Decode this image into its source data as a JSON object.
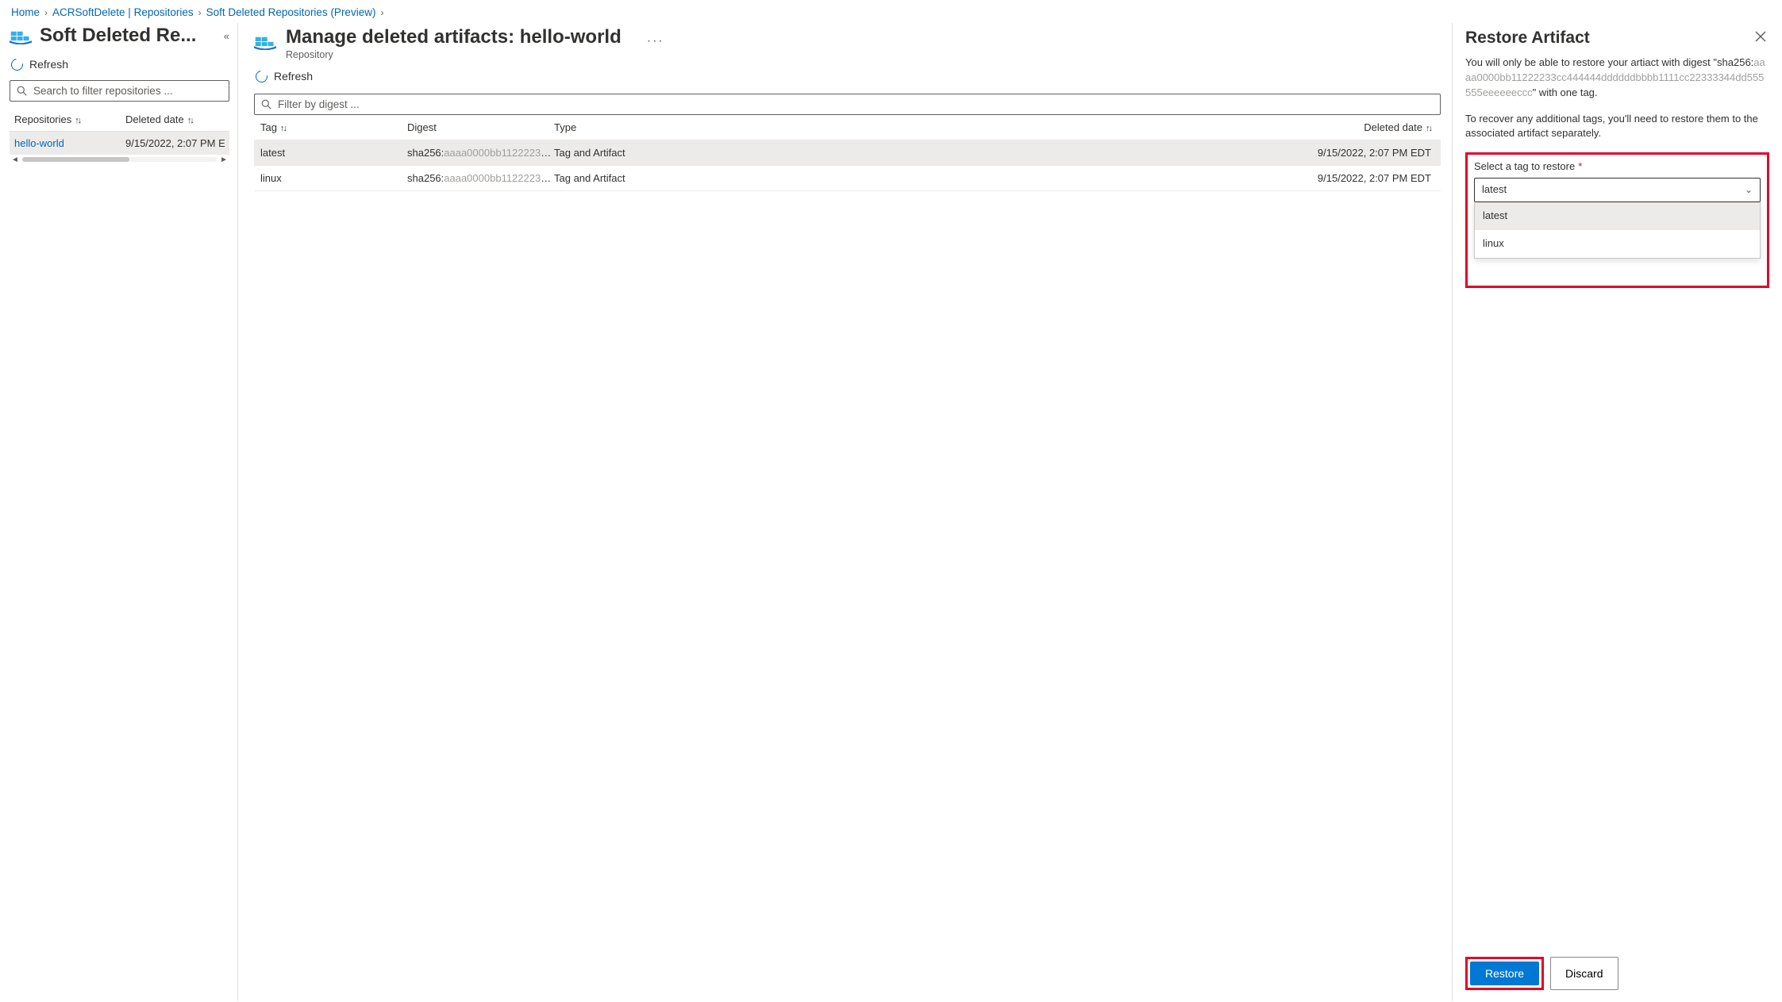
{
  "breadcrumb": {
    "items": [
      "Home",
      "ACRSoftDelete | Repositories",
      "Soft Deleted Repositories (Preview)"
    ]
  },
  "left": {
    "title": "Soft Deleted Re...",
    "refresh": "Refresh",
    "search_placeholder": "Search to filter repositories ...",
    "col_repo": "Repositories",
    "col_date": "Deleted date",
    "rows": [
      {
        "name": "hello-world",
        "date": "9/15/2022, 2:07 PM E"
      }
    ]
  },
  "main": {
    "title": "Manage deleted artifacts: hello-world",
    "subtitle": "Repository",
    "refresh": "Refresh",
    "filter_placeholder": "Filter by digest ...",
    "cols": {
      "tag": "Tag",
      "digest": "Digest",
      "type": "Type",
      "date": "Deleted date"
    },
    "rows": [
      {
        "tag": "latest",
        "digest_pre": "sha256:",
        "digest_hash": "aaaa0000bb11222233c...",
        "type": "Tag and Artifact",
        "date": "9/15/2022, 2:07 PM EDT"
      },
      {
        "tag": "linux",
        "digest_pre": "sha256:",
        "digest_hash": "aaaa0000bb11222233c...",
        "type": "Tag and Artifact",
        "date": "9/15/2022, 2:07 PM EDT"
      }
    ]
  },
  "right": {
    "title": "Restore Artifact",
    "p1a": "You will only be able to restore your artiact with digest \"sha256:",
    "p1_hash": "aaaa0000bb11222233cc444444ddddddbbbb1111cc22333344dd555555eeeeeeccc",
    "p1b": "\" with one tag.",
    "p2": "To recover any additional tags, you'll need to restore them to the associated artifact separately.",
    "label": "Select a tag to restore",
    "selected": "latest",
    "options": [
      "latest",
      "linux"
    ],
    "restore": "Restore",
    "discard": "Discard"
  }
}
